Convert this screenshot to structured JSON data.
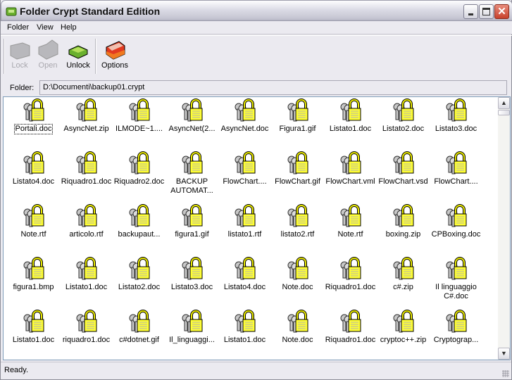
{
  "window": {
    "title": "Folder Crypt Standard Edition"
  },
  "menu": [
    "Folder",
    "View",
    "Help"
  ],
  "toolbar": {
    "lock": "Lock",
    "open": "Open",
    "unlock": "Unlock",
    "options": "Options"
  },
  "folder": {
    "label": "Folder:",
    "value": "D:\\Documenti\\backup01.crypt"
  },
  "files": [
    [
      "Portali.doc",
      "AsyncNet.zip",
      "ILMODE~1....",
      "AsyncNet(2...",
      "AsyncNet.doc",
      "Figura1.gif",
      "Listato1.doc",
      "Listato2.doc",
      "Listato3.doc"
    ],
    [
      "Listato4.doc",
      "Riquadro1.doc",
      "Riquadro2.doc",
      "BACKUP AUTOMAT...",
      "FlowChart....",
      "FlowChart.gif",
      "FlowChart.vml",
      "FlowChart.vsd",
      "FlowChart...."
    ],
    [
      "Note.rtf",
      "articolo.rtf",
      "backupaut...",
      "figura1.gif",
      "listato1.rtf",
      "listato2.rtf",
      "Note.rtf",
      "boxing.zip",
      "CPBoxing.doc"
    ],
    [
      "figura1.bmp",
      "Listato1.doc",
      "Listato2.doc",
      "Listato3.doc",
      "Listato4.doc",
      "Note.doc",
      "Riquadro1.doc",
      "c#.zip",
      "Il linguaggio C#.doc"
    ],
    [
      "Listato1.doc",
      "riquadro1.doc",
      "c#dotnet.gif",
      "Il_linguaggi...",
      "Listato1.doc",
      "Note.doc",
      "Riquadro1.doc",
      "cryptoc++.zip",
      "Cryptograp..."
    ]
  ],
  "status": "Ready."
}
